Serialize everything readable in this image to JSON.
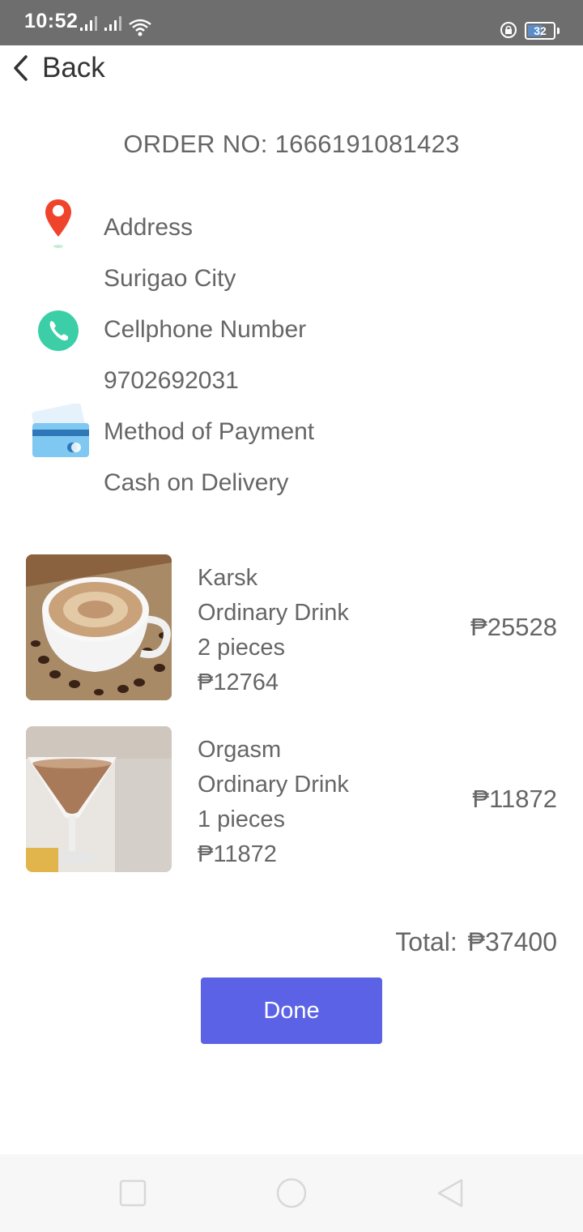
{
  "status_bar": {
    "time": "10:52",
    "battery": "32"
  },
  "header": {
    "back_label": "Back"
  },
  "order": {
    "number_label": "ORDER NO: 1666191081423"
  },
  "info": {
    "address_label": "Address",
    "address_value": "Surigao City",
    "phone_label": "Cellphone Number",
    "phone_value": "9702692031",
    "payment_label": "Method of Payment",
    "payment_value": "Cash on Delivery"
  },
  "items": [
    {
      "name": "Karsk",
      "category": "Ordinary Drink",
      "quantity": "2 pieces",
      "unit_price": "₱12764",
      "subtotal": "₱25528"
    },
    {
      "name": "Orgasm",
      "category": "Ordinary Drink",
      "quantity": "1 pieces",
      "unit_price": "₱11872",
      "subtotal": "₱11872"
    }
  ],
  "total_label": "Total:  ₱37400",
  "done_label": "Done",
  "colors": {
    "accent": "#5b62e6",
    "pin": "#f0432c",
    "phone": "#3ccfa7",
    "card": "#7ec8f2"
  },
  "icons": [
    "back-chevron-icon",
    "location-pin-icon",
    "phone-icon",
    "credit-card-icon",
    "nav-square-icon",
    "nav-circle-icon",
    "nav-triangle-icon"
  ]
}
